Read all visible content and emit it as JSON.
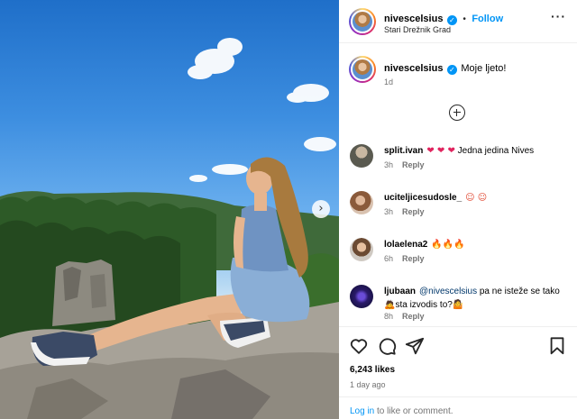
{
  "post": {
    "author": "nivescelsius",
    "follow_label": "Follow",
    "location": "Stari Drežnik Grad",
    "caption": "Moje ljeto!",
    "caption_age": "1d",
    "likes": "6,243 likes",
    "posted": "1 day ago"
  },
  "comments": [
    {
      "user": "split.ivan",
      "emoji": "❤ ❤ ❤",
      "emoji_kind": "heart",
      "text": " Jedna jedina Nives",
      "age": "3h",
      "reply": "Reply"
    },
    {
      "user": "uciteljicesudosle_",
      "emoji": "☺ ☺",
      "emoji_kind": "face",
      "text": "",
      "age": "3h",
      "reply": "Reply"
    },
    {
      "user": "lolaelena2",
      "emoji": "🔥🔥🔥",
      "emoji_kind": "fire",
      "text": "",
      "age": "6h",
      "reply": "Reply"
    },
    {
      "user": "ljubaan",
      "mention": "@nivescelsius",
      "text": " pa ne isteže se tako",
      "text2": "sta izvodis to?",
      "age": "8h",
      "reply": "Reply"
    }
  ],
  "footer": {
    "login_link": "Log in",
    "login_rest": " to like or comment."
  },
  "icons": {
    "like": "heart-outline-icon",
    "comment": "speech-bubble-icon",
    "share": "paper-plane-icon",
    "save": "bookmark-icon",
    "more": "ellipsis-icon",
    "next": "chevron-right-icon",
    "add": "plus-circle-icon"
  }
}
